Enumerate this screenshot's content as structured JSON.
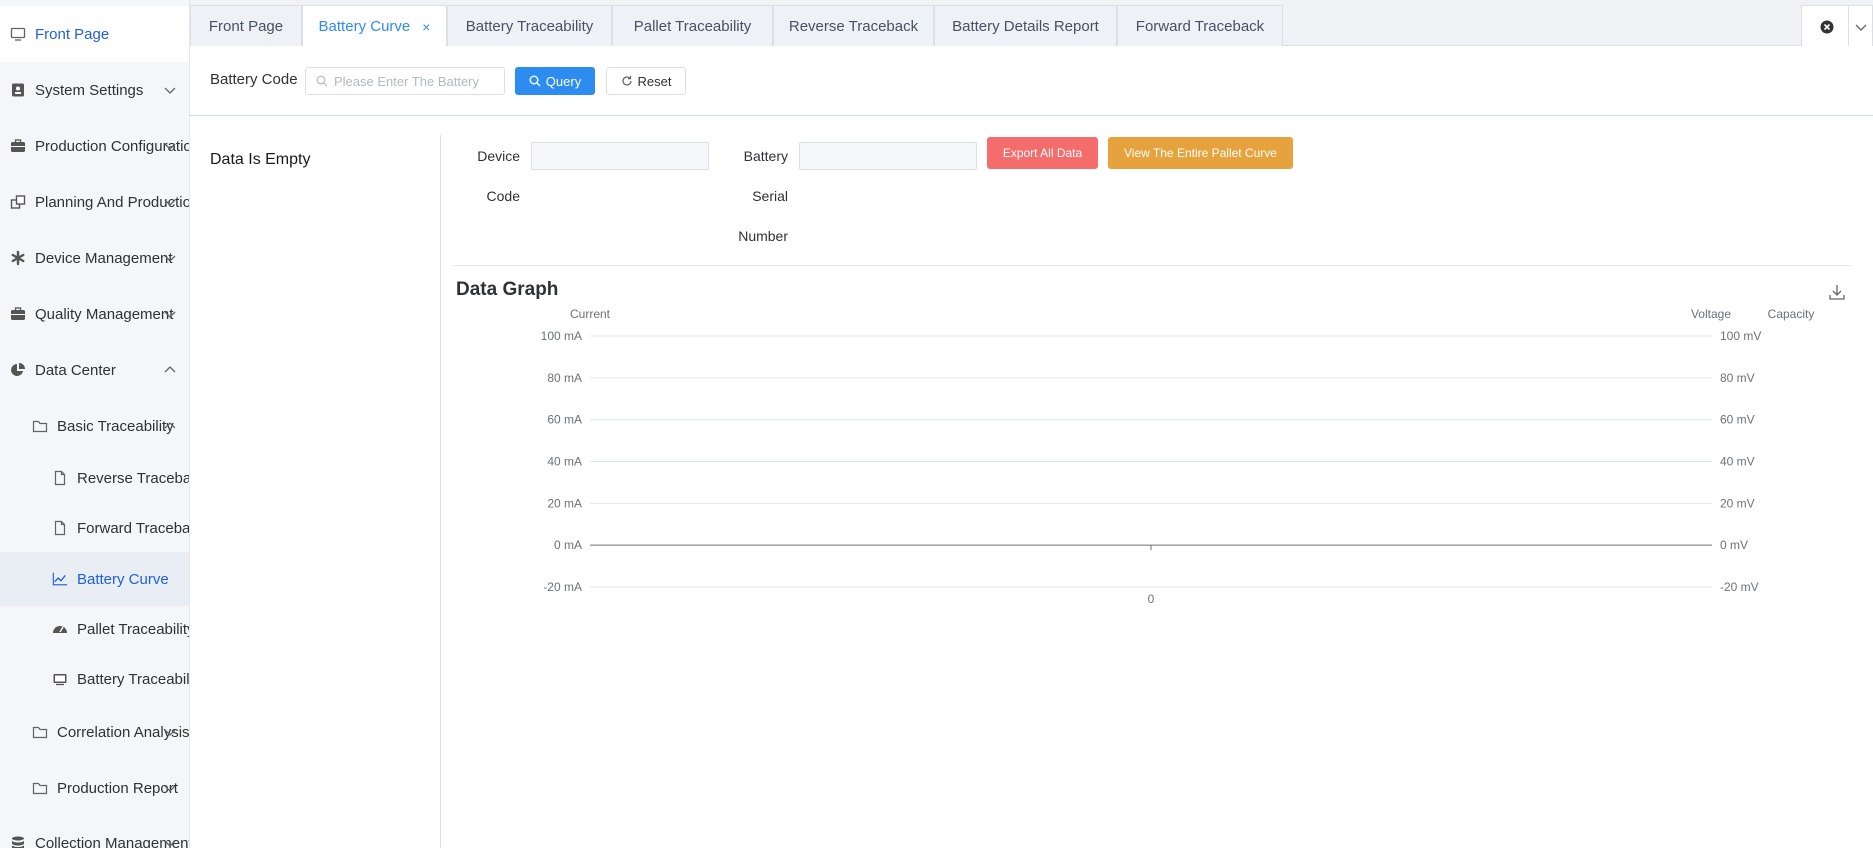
{
  "sidebar": {
    "items": [
      {
        "label": "Front Page",
        "icon": "monitor-icon"
      },
      {
        "label": "System Settings",
        "icon": "user-card-icon"
      },
      {
        "label": "Production Configuration",
        "icon": "briefcase-icon"
      },
      {
        "label": "Planning And Production",
        "icon": "windows-icon"
      },
      {
        "label": "Device Management",
        "icon": "asterisk-icon"
      },
      {
        "label": "Quality Management",
        "icon": "briefcase-icon"
      },
      {
        "label": "Data Center",
        "icon": "pie-chart-icon"
      },
      {
        "label": "Basic Traceability",
        "icon": "folder-icon"
      },
      {
        "label": "Reverse Traceback",
        "icon": "document-icon"
      },
      {
        "label": "Forward Traceback",
        "icon": "document-icon"
      },
      {
        "label": "Battery Curve",
        "icon": "line-chart-icon"
      },
      {
        "label": "Pallet Traceability",
        "icon": "gauge-icon"
      },
      {
        "label": "Battery Traceability",
        "icon": "monitor-icon"
      },
      {
        "label": "Correlation Analysis",
        "icon": "folder-icon"
      },
      {
        "label": "Production Report",
        "icon": "folder-icon"
      },
      {
        "label": "Collection Management",
        "icon": "database-icon"
      }
    ]
  },
  "tabs": [
    {
      "label": "Front Page"
    },
    {
      "label": "Battery Curve",
      "close": "×"
    },
    {
      "label": "Battery Traceability"
    },
    {
      "label": "Pallet Traceability"
    },
    {
      "label": "Reverse Traceback"
    },
    {
      "label": "Battery Details Report"
    },
    {
      "label": "Forward Traceback"
    }
  ],
  "query": {
    "label": "Battery Code",
    "placeholder": "Please Enter The Battery",
    "query_button": "Query",
    "reset_button": "Reset"
  },
  "left_panel": {
    "empty_text": "Data Is Empty"
  },
  "form": {
    "device_label_1": "Device",
    "device_label_2": "Code",
    "battery_label_1": "Battery",
    "battery_label_2": "Serial",
    "battery_label_3": "Number",
    "export_button": "Export All Data",
    "pallet_button": "View The Entire Pallet Curve"
  },
  "graph": {
    "title": "Data Graph"
  },
  "chart_data": {
    "type": "line",
    "title": "",
    "x": [
      "0"
    ],
    "series": [],
    "y_left": {
      "name": "Current",
      "ticks": [
        "100 mA",
        "80 mA",
        "60 mA",
        "40 mA",
        "20 mA",
        "0 mA",
        "-20 mA"
      ],
      "range": [
        -20,
        100
      ]
    },
    "y_right": {
      "names": [
        "Voltage",
        "Capacity"
      ],
      "ticks": [
        "100 mV",
        "80 mV",
        "60 mV",
        "40 mV",
        "20 mV",
        "0 mV",
        "-20 mV"
      ],
      "range": [
        -20,
        100
      ]
    },
    "grid": true
  }
}
